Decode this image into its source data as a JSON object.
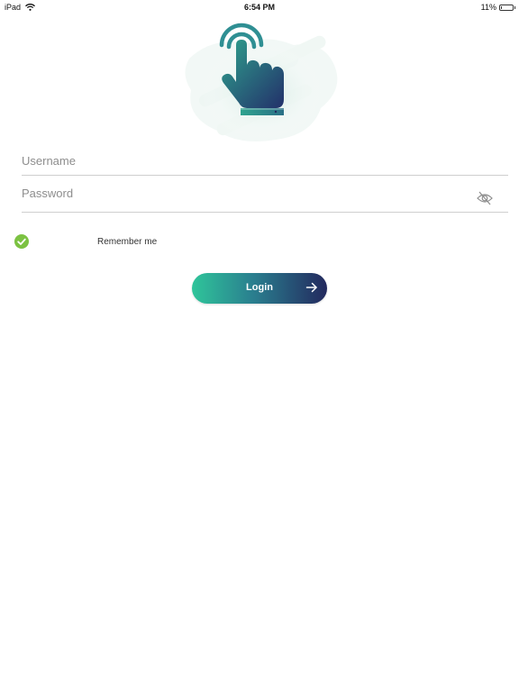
{
  "status_bar": {
    "device": "iPad",
    "time": "6:54 PM",
    "battery_percent": "11%",
    "battery_level": 0.11,
    "icons": [
      "wifi-icon",
      "battery-icon"
    ]
  },
  "hero": {
    "icon": "tap-gesture-icon",
    "colors": {
      "teal": "#2fa38e",
      "navy": "#23295e",
      "splash": "#e7f3ee"
    }
  },
  "form": {
    "username_placeholder": "Username",
    "username_value": "",
    "password_placeholder": "Password",
    "password_value": "",
    "password_toggle_icon": "eye-slash-icon",
    "remember_label": "Remember me",
    "remember_checked": true,
    "remember_color": "#7cc242"
  },
  "login": {
    "label": "Login",
    "arrow_icon": "arrow-right-icon",
    "gradient": [
      "#2fc59a",
      "#23295e"
    ]
  }
}
